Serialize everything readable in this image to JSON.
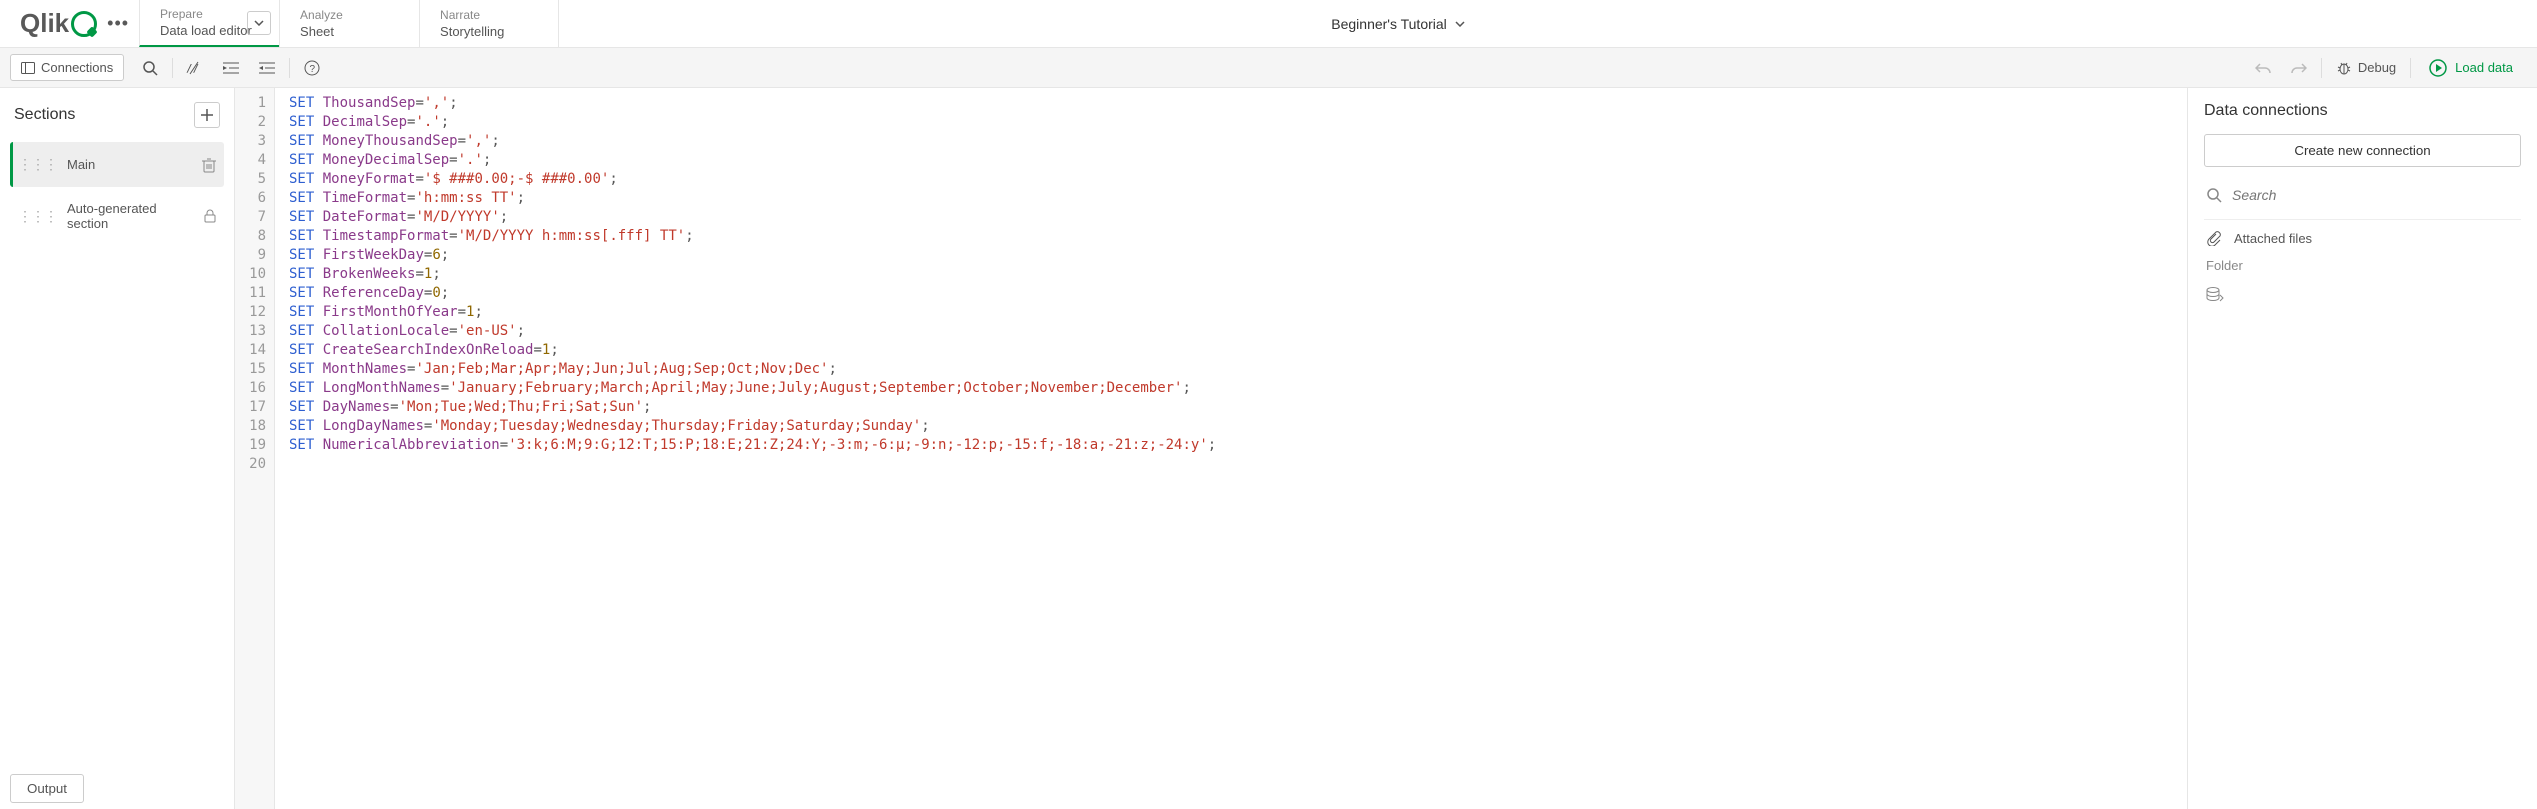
{
  "logo_text": "Qlik",
  "header": {
    "tabs": [
      {
        "small": "Prepare",
        "big": "Data load editor",
        "has_chevron": true,
        "active": true
      },
      {
        "small": "Analyze",
        "big": "Sheet",
        "has_chevron": false,
        "active": false
      },
      {
        "small": "Narrate",
        "big": "Storytelling",
        "has_chevron": false,
        "active": false
      }
    ],
    "app_title": "Beginner's Tutorial"
  },
  "toolbar": {
    "connections_label": "Connections",
    "debug_label": "Debug",
    "load_label": "Load data"
  },
  "sections": {
    "title": "Sections",
    "items": [
      {
        "label": "Main",
        "active": true,
        "end_icon": "trash"
      },
      {
        "label": "Auto-generated section",
        "active": false,
        "end_icon": "lock"
      }
    ]
  },
  "code": {
    "lines": [
      {
        "n": 1,
        "kw": "SET",
        "var": "ThousandSep",
        "rest_type": "str",
        "rest": "=','",
        "tail": ";"
      },
      {
        "n": 2,
        "kw": "SET",
        "var": "DecimalSep",
        "rest_type": "str",
        "rest": "='.'",
        "tail": ";"
      },
      {
        "n": 3,
        "kw": "SET",
        "var": "MoneyThousandSep",
        "rest_type": "str",
        "rest": "=','",
        "tail": ";"
      },
      {
        "n": 4,
        "kw": "SET",
        "var": "MoneyDecimalSep",
        "rest_type": "str",
        "rest": "='.'",
        "tail": ";"
      },
      {
        "n": 5,
        "kw": "SET",
        "var": "MoneyFormat",
        "rest_type": "str",
        "rest": "='$ ###0.00;-$ ###0.00'",
        "tail": ";"
      },
      {
        "n": 6,
        "kw": "SET",
        "var": "TimeFormat",
        "rest_type": "str",
        "rest": "='h:mm:ss TT'",
        "tail": ";"
      },
      {
        "n": 7,
        "kw": "SET",
        "var": "DateFormat",
        "rest_type": "str",
        "rest": "='M/D/YYYY'",
        "tail": ";"
      },
      {
        "n": 8,
        "kw": "SET",
        "var": "TimestampFormat",
        "rest_type": "str",
        "rest": "='M/D/YYYY h:mm:ss[.fff] TT'",
        "tail": ";"
      },
      {
        "n": 9,
        "kw": "SET",
        "var": "FirstWeekDay",
        "rest_type": "num",
        "rest": "=6",
        "tail": ";"
      },
      {
        "n": 10,
        "kw": "SET",
        "var": "BrokenWeeks",
        "rest_type": "num",
        "rest": "=1",
        "tail": ";"
      },
      {
        "n": 11,
        "kw": "SET",
        "var": "ReferenceDay",
        "rest_type": "num",
        "rest": "=0",
        "tail": ";"
      },
      {
        "n": 12,
        "kw": "SET",
        "var": "FirstMonthOfYear",
        "rest_type": "num",
        "rest": "=1",
        "tail": ";"
      },
      {
        "n": 13,
        "kw": "SET",
        "var": "CollationLocale",
        "rest_type": "str",
        "rest": "='en-US'",
        "tail": ";"
      },
      {
        "n": 14,
        "kw": "SET",
        "var": "CreateSearchIndexOnReload",
        "rest_type": "num",
        "rest": "=1",
        "tail": ";"
      },
      {
        "n": 15,
        "kw": "SET",
        "var": "MonthNames",
        "rest_type": "str",
        "rest": "='Jan;Feb;Mar;Apr;May;Jun;Jul;Aug;Sep;Oct;Nov;Dec'",
        "tail": ";"
      },
      {
        "n": 16,
        "kw": "SET",
        "var": "LongMonthNames",
        "rest_type": "str",
        "rest": "='January;February;March;April;May;June;July;August;September;October;November;December'",
        "tail": ";"
      },
      {
        "n": 17,
        "kw": "SET",
        "var": "DayNames",
        "rest_type": "str",
        "rest": "='Mon;Tue;Wed;Thu;Fri;Sat;Sun'",
        "tail": ";"
      },
      {
        "n": 18,
        "kw": "SET",
        "var": "LongDayNames",
        "rest_type": "str",
        "rest": "='Monday;Tuesday;Wednesday;Thursday;Friday;Saturday;Sunday'",
        "tail": ";"
      },
      {
        "n": 19,
        "kw": "SET",
        "var": "NumericalAbbreviation",
        "rest_type": "str",
        "rest": "='3:k;6:M;9:G;12:T;15:P;18:E;21:Z;24:Y;-3:m;-6:μ;-9:n;-12:p;-15:f;-18:a;-21:z;-24:y'",
        "tail": ";"
      },
      {
        "n": 20,
        "kw": "",
        "var": "",
        "rest_type": "",
        "rest": "",
        "tail": ""
      }
    ]
  },
  "connections": {
    "title": "Data connections",
    "new_btn": "Create new connection",
    "search_placeholder": "Search",
    "attached_label": "Attached files",
    "folder_label": "Folder"
  },
  "output_label": "Output"
}
